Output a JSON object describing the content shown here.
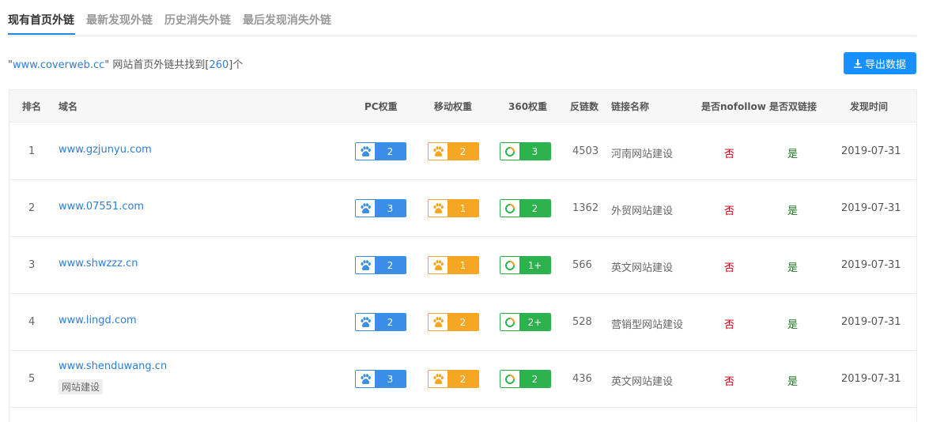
{
  "tabs": [
    {
      "label": "现有首页外链",
      "active": true
    },
    {
      "label": "最新发现外链",
      "active": false
    },
    {
      "label": "历史消失外链",
      "active": false
    },
    {
      "label": "最后发现消失外链",
      "active": false
    }
  ],
  "summary": {
    "quote_open": "\"",
    "site": "www.coverweb.cc",
    "middle": "\" 网站首页外链共找到[",
    "count": "260",
    "end": "]个"
  },
  "export_label": "导出数据",
  "columns": {
    "rank": "排名",
    "domain": "域名",
    "pc": "PC权重",
    "mobile": "移动权重",
    "w360": "360权重",
    "backlinks": "反链数",
    "linkname": "链接名称",
    "nofollow": "是否nofollow",
    "double": "是否双链接",
    "date": "发现时间"
  },
  "rows": [
    {
      "rank": "1",
      "domain": "www.gzjunyu.com",
      "tag": "",
      "pc": "2",
      "mobile": "2",
      "w360": "3",
      "backlinks": "4503",
      "linkname": "河南网站建设",
      "nofollow": "否",
      "double": "是",
      "date": "2019-07-31"
    },
    {
      "rank": "2",
      "domain": "www.07551.com",
      "tag": "",
      "pc": "3",
      "mobile": "1",
      "w360": "2",
      "backlinks": "1362",
      "linkname": "外贸网站建设",
      "nofollow": "否",
      "double": "是",
      "date": "2019-07-31"
    },
    {
      "rank": "3",
      "domain": "www.shwzzz.cn",
      "tag": "",
      "pc": "2",
      "mobile": "1",
      "w360": "1+",
      "backlinks": "566",
      "linkname": "英文网站建设",
      "nofollow": "否",
      "double": "是",
      "date": "2019-07-31"
    },
    {
      "rank": "4",
      "domain": "www.lingd.com",
      "tag": "",
      "pc": "2",
      "mobile": "2",
      "w360": "2+",
      "backlinks": "528",
      "linkname": "营销型网站建设",
      "nofollow": "否",
      "double": "是",
      "date": "2019-07-31"
    },
    {
      "rank": "5",
      "domain": "www.shenduwang.cn",
      "tag": "网站建设",
      "pc": "3",
      "mobile": "2",
      "w360": "2",
      "backlinks": "436",
      "linkname": "英文网站建设",
      "nofollow": "否",
      "double": "是",
      "date": "2019-07-31"
    }
  ],
  "icons": {
    "pc": "baidu-paw-icon",
    "mobile": "baidu-paw-icon",
    "w360": "360-ring-icon",
    "export": "download-icon"
  },
  "colors": {
    "accent": "#1890ff",
    "pc": "#3a8ee6",
    "mobile": "#f5a623",
    "w360": "#2bb24c",
    "no": "#c7000b",
    "yes": "#1a7a1a"
  }
}
